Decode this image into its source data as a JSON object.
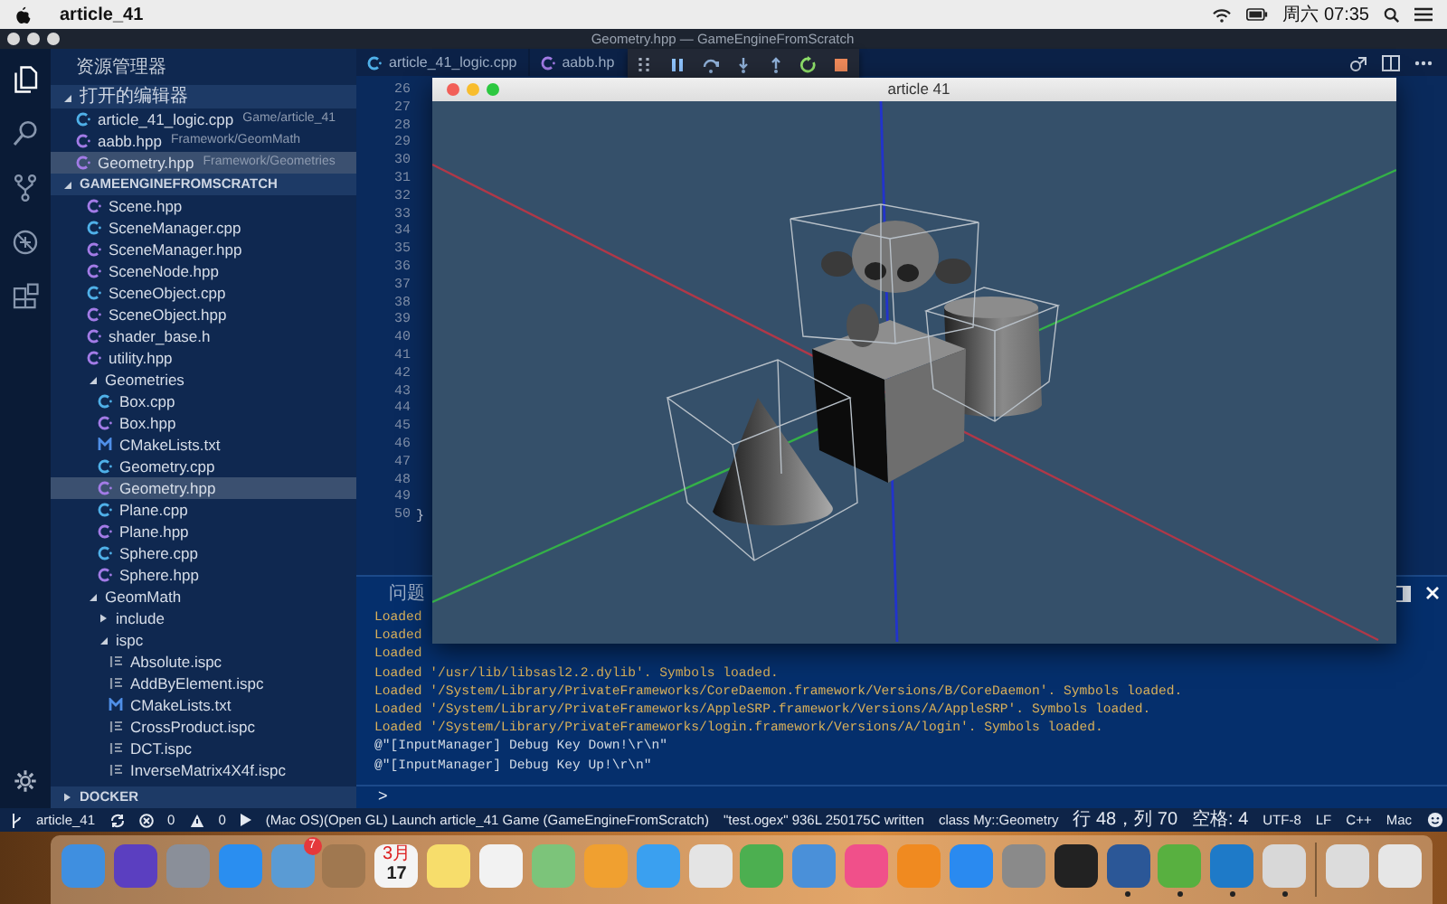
{
  "menubar": {
    "app_name": "article_41",
    "clock": "周六 07:35"
  },
  "window": {
    "title": "Geometry.hpp — GameEngineFromScratch"
  },
  "activity_bar": [
    {
      "kind": "explorer",
      "selected": true
    },
    {
      "kind": "search",
      "selected": false
    },
    {
      "kind": "source-control",
      "selected": false
    },
    {
      "kind": "debug",
      "selected": false
    },
    {
      "kind": "extensions",
      "selected": false
    }
  ],
  "sidebar": {
    "title": "资源管理器",
    "open_editors": {
      "title": "打开的编辑器",
      "expanded": true,
      "items": [
        {
          "label": "article_41_logic.cpp",
          "path": "Game/article_41",
          "kind": "cpp",
          "selected": false
        },
        {
          "label": "aabb.hpp",
          "path": "Framework/GeomMath",
          "kind": "hpp",
          "selected": false
        },
        {
          "label": "Geometry.hpp",
          "path": "Framework/Geometries",
          "kind": "hpp",
          "selected": true
        }
      ]
    },
    "project": {
      "title": "GAMEENGINEFROMSCRATCH",
      "expanded": true,
      "items": [
        {
          "label": "Scene.hpp",
          "kind": "hpp",
          "selected": false
        },
        {
          "label": "SceneManager.cpp",
          "kind": "cpp",
          "selected": false
        },
        {
          "label": "SceneManager.hpp",
          "kind": "hpp",
          "selected": false
        },
        {
          "label": "SceneNode.hpp",
          "kind": "hpp",
          "selected": false
        },
        {
          "label": "SceneObject.cpp",
          "kind": "cpp",
          "selected": false
        },
        {
          "label": "SceneObject.hpp",
          "kind": "hpp",
          "selected": false
        },
        {
          "label": "shader_base.h",
          "kind": "h",
          "selected": false
        },
        {
          "label": "utility.hpp",
          "kind": "hpp",
          "selected": false
        },
        {
          "label": "Geometries",
          "kind": "folder",
          "expanded": true,
          "selected": false,
          "children": [
            {
              "label": "Box.cpp",
              "kind": "cpp",
              "selected": false
            },
            {
              "label": "Box.hpp",
              "kind": "hpp",
              "selected": false
            },
            {
              "label": "CMakeLists.txt",
              "kind": "cmake",
              "selected": false
            },
            {
              "label": "Geometry.cpp",
              "kind": "cpp",
              "selected": false
            },
            {
              "label": "Geometry.hpp",
              "kind": "hpp",
              "selected": true
            },
            {
              "label": "Plane.cpp",
              "kind": "cpp",
              "selected": false
            },
            {
              "label": "Plane.hpp",
              "kind": "hpp",
              "selected": false
            },
            {
              "label": "Sphere.cpp",
              "kind": "cpp",
              "selected": false
            },
            {
              "label": "Sphere.hpp",
              "kind": "hpp",
              "selected": false
            }
          ]
        },
        {
          "label": "GeomMath",
          "kind": "folder",
          "expanded": true,
          "selected": false,
          "children": [
            {
              "label": "include",
              "kind": "folder",
              "expanded": false,
              "selected": false
            },
            {
              "label": "ispc",
              "kind": "folder",
              "expanded": true,
              "selected": false,
              "children": [
                {
                  "label": "Absolute.ispc",
                  "kind": "ispc",
                  "selected": false
                },
                {
                  "label": "AddByElement.ispc",
                  "kind": "ispc",
                  "selected": false
                },
                {
                  "label": "CMakeLists.txt",
                  "kind": "cmake",
                  "selected": false
                },
                {
                  "label": "CrossProduct.ispc",
                  "kind": "ispc",
                  "selected": false
                },
                {
                  "label": "DCT.ispc",
                  "kind": "ispc",
                  "selected": false
                },
                {
                  "label": "InverseMatrix4X4f.ispc",
                  "kind": "ispc",
                  "selected": false
                }
              ]
            }
          ]
        }
      ]
    },
    "docker": {
      "title": "DOCKER",
      "expanded": false
    }
  },
  "tabs": [
    {
      "label": "article_41_logic.cpp",
      "kind": "cpp",
      "selected": false
    },
    {
      "label": "aabb.hp",
      "kind": "hpp",
      "selected": false
    }
  ],
  "debug_toolbar": [
    {
      "kind": "grip"
    },
    {
      "kind": "pause"
    },
    {
      "kind": "step-over"
    },
    {
      "kind": "step-into"
    },
    {
      "kind": "step-out"
    },
    {
      "kind": "restart"
    },
    {
      "kind": "stop"
    }
  ],
  "editor": {
    "lines": [
      {
        "number": "26"
      },
      {
        "number": "27"
      },
      {
        "number": "28"
      },
      {
        "number": "29"
      },
      {
        "number": "30"
      },
      {
        "number": "31"
      },
      {
        "number": "32"
      },
      {
        "number": "33"
      },
      {
        "number": "34"
      },
      {
        "number": "35"
      },
      {
        "number": "36"
      },
      {
        "number": "37"
      },
      {
        "number": "38"
      },
      {
        "number": "39"
      },
      {
        "number": "40"
      },
      {
        "number": "41"
      },
      {
        "number": "42"
      },
      {
        "number": "43"
      },
      {
        "number": "44"
      },
      {
        "number": "45"
      },
      {
        "number": "46"
      },
      {
        "number": "47"
      },
      {
        "number": "48"
      },
      {
        "number": "49"
      },
      {
        "number": "50",
        "code": "}"
      }
    ]
  },
  "panel": {
    "tabs": [
      {
        "label": "问题",
        "selected": false
      }
    ],
    "output": [
      {
        "kind": "log",
        "text": "Loaded"
      },
      {
        "kind": "log",
        "text": "Loaded"
      },
      {
        "kind": "log",
        "text": "Loaded"
      },
      {
        "kind": "log",
        "text": "Loaded '/usr/lib/libsasl2.2.dylib'. Symbols loaded."
      },
      {
        "kind": "log",
        "text": "Loaded '/System/Library/PrivateFrameworks/CoreDaemon.framework/Versions/B/CoreDaemon'. Symbols loaded."
      },
      {
        "kind": "log",
        "text": "Loaded '/System/Library/PrivateFrameworks/AppleSRP.framework/Versions/A/AppleSRP'. Symbols loaded."
      },
      {
        "kind": "log",
        "text": "Loaded '/System/Library/PrivateFrameworks/login.framework/Versions/A/login'. Symbols loaded."
      },
      {
        "kind": "message",
        "text": "@\"[InputManager] Debug Key Down!\\r\\n\""
      },
      {
        "kind": "message",
        "text": "@\"[InputManager] Debug Key Up!\\r\\n\""
      }
    ],
    "prompt": ">"
  },
  "status_bar": {
    "branch": "article_41",
    "errors": "0",
    "warnings": "0",
    "launch": "(Mac OS)(Open GL) Launch article_41 Game (GameEngineFromScratch)",
    "message": "\"test.ogex\" 936L 250175C written",
    "right": [
      "class My::Geometry",
      "行 48，列 70",
      "空格: 4",
      "UTF-8",
      "LF",
      "C++",
      "Mac"
    ]
  },
  "game_window": {
    "title": "article 41"
  },
  "dock": [
    {
      "kind": "app",
      "color": "#3f8fe0",
      "running": false
    },
    {
      "kind": "app",
      "color": "#5b3fc0",
      "running": false
    },
    {
      "kind": "app",
      "color": "#8a8f99",
      "running": false
    },
    {
      "kind": "app",
      "color": "#2a8ef0",
      "running": false
    },
    {
      "kind": "app",
      "color": "#5a9bd4",
      "running": false,
      "badge": "7"
    },
    {
      "kind": "app",
      "color": "#a07850",
      "running": false
    },
    {
      "kind": "calendar",
      "color": "#f4f4f4",
      "running": false,
      "month": "3月",
      "day": "17"
    },
    {
      "kind": "app",
      "color": "#f7dd6b",
      "running": false
    },
    {
      "kind": "app",
      "color": "#f2f2f2",
      "running": false
    },
    {
      "kind": "app",
      "color": "#7cc47a",
      "running": false
    },
    {
      "kind": "app",
      "color": "#f0a030",
      "running": false
    },
    {
      "kind": "app",
      "color": "#3aa0f0",
      "running": false
    },
    {
      "kind": "app",
      "color": "#e4e4e4",
      "running": false
    },
    {
      "kind": "app",
      "color": "#4caf50",
      "running": false
    },
    {
      "kind": "app",
      "color": "#4a90d9",
      "running": false
    },
    {
      "kind": "app",
      "color": "#f0508a",
      "running": false
    },
    {
      "kind": "app",
      "color": "#f08a20",
      "running": false
    },
    {
      "kind": "app",
      "color": "#2a8af0",
      "running": false
    },
    {
      "kind": "app",
      "color": "#8a8a8a",
      "running": false
    },
    {
      "kind": "app",
      "color": "#222222",
      "running": false
    },
    {
      "kind": "app",
      "color": "#2b5797",
      "running": true
    },
    {
      "kind": "app",
      "color": "#58b040",
      "running": true
    },
    {
      "kind": "app",
      "color": "#1e7ac8",
      "running": true
    },
    {
      "kind": "app",
      "color": "#d8d8d8",
      "running": true
    },
    {
      "kind": "separator"
    },
    {
      "kind": "app",
      "color": "#dcdcdc",
      "running": false
    },
    {
      "kind": "app",
      "color": "#e6e6e6",
      "running": false
    }
  ]
}
